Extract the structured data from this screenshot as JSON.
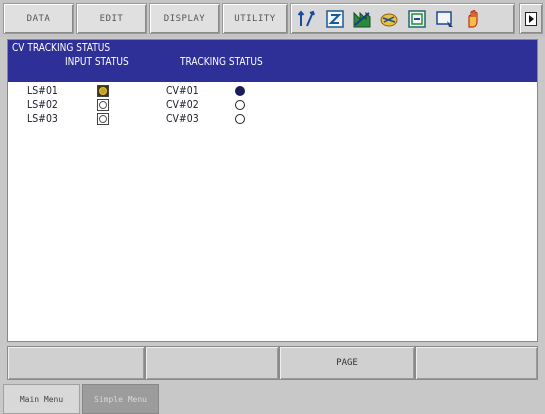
{
  "menu": {
    "data": "DATA",
    "edit": "EDIT",
    "display": "DISPLAY",
    "utility": "UTILITY"
  },
  "status_icons": [
    "coordinate-icon",
    "edit-mode-icon",
    "step-icon",
    "speed-icon",
    "cycle-icon",
    "screen-icon",
    "hand-icon"
  ],
  "screen": {
    "title": "CV TRACKING STATUS",
    "header_input": "INPUT STATUS",
    "header_tracking": "TRACKING STATUS",
    "rows": [
      {
        "input_label": "LS#01",
        "input_on": true,
        "cv_label": "CV#01",
        "tracking_on": true
      },
      {
        "input_label": "LS#02",
        "input_on": false,
        "cv_label": "CV#02",
        "tracking_on": false
      },
      {
        "input_label": "LS#03",
        "input_on": false,
        "cv_label": "CV#03",
        "tracking_on": false
      }
    ]
  },
  "function_keys": [
    "",
    "",
    "PAGE",
    ""
  ],
  "tabs": {
    "main": "Main Menu",
    "simple": "Simple Menu"
  }
}
